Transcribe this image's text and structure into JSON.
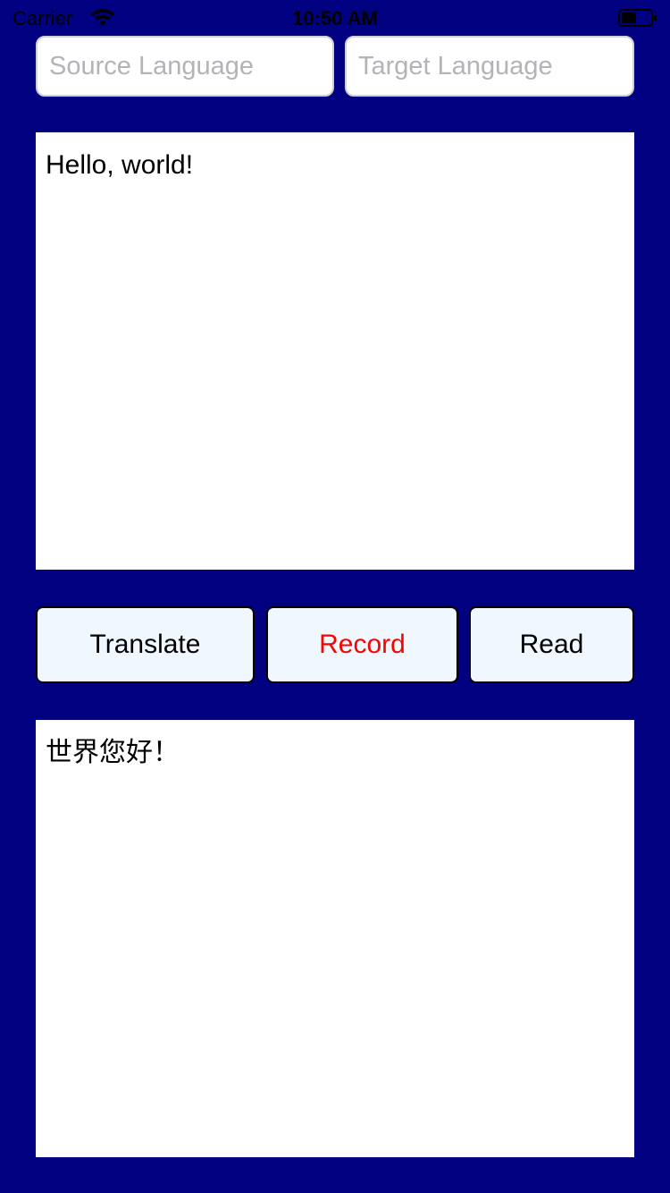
{
  "status_bar": {
    "carrier": "Carrier",
    "time": "10:50 AM",
    "wifi_icon": "wifi-icon",
    "battery_icon": "battery-icon"
  },
  "language": {
    "source_placeholder": "Source Language",
    "source_value": "",
    "target_placeholder": "Target Language",
    "target_value": ""
  },
  "input_text": "Hello, world!",
  "buttons": {
    "translate": "Translate",
    "record": "Record",
    "read": "Read"
  },
  "output_text": "世界您好！",
  "colors": {
    "background": "#000080",
    "button_bg": "#f0f7ff",
    "record_text": "#ff0000"
  }
}
